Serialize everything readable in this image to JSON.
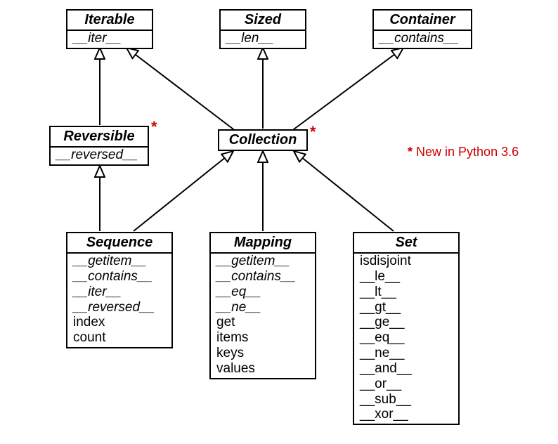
{
  "classes": {
    "iterable": {
      "name": "Iterable",
      "methods": [
        "__iter__"
      ]
    },
    "sized": {
      "name": "Sized",
      "methods": [
        "__len__"
      ]
    },
    "container": {
      "name": "Container",
      "methods": [
        "__contains__"
      ]
    },
    "reversible": {
      "name": "Reversible",
      "methods": [
        "__reversed__"
      ]
    },
    "collection": {
      "name": "Collection",
      "methods": []
    },
    "sequence": {
      "name": "Sequence",
      "methods": [
        "__getitem__",
        "__contains__",
        "__iter__",
        "__reversed__",
        "index",
        "count"
      ]
    },
    "mapping": {
      "name": "Mapping",
      "methods": [
        "__getitem__",
        "__contains__",
        "__eq__",
        "__ne__",
        "get",
        "items",
        "keys",
        "values"
      ]
    },
    "set": {
      "name": "Set",
      "methods": [
        "isdisjoint",
        "__le__",
        "__lt__",
        "__gt__",
        "__ge__",
        "__eq__",
        "__ne__",
        "__and__",
        "__or__",
        "__sub__",
        "__xor__"
      ]
    }
  },
  "asterisk": "*",
  "note_prefix": "* ",
  "note_text": "New in Python 3.6",
  "italic_methods": {
    "iterable": [
      0
    ],
    "sized": [
      0
    ],
    "container": [
      0
    ],
    "reversible": [
      0
    ],
    "sequence": [
      0,
      1,
      2,
      3
    ],
    "mapping": [
      0,
      1,
      2,
      3
    ]
  },
  "inheritance": [
    [
      "reversible",
      "iterable"
    ],
    [
      "collection",
      "iterable"
    ],
    [
      "collection",
      "sized"
    ],
    [
      "collection",
      "container"
    ],
    [
      "sequence",
      "reversible"
    ],
    [
      "sequence",
      "collection"
    ],
    [
      "mapping",
      "collection"
    ],
    [
      "set",
      "collection"
    ]
  ]
}
